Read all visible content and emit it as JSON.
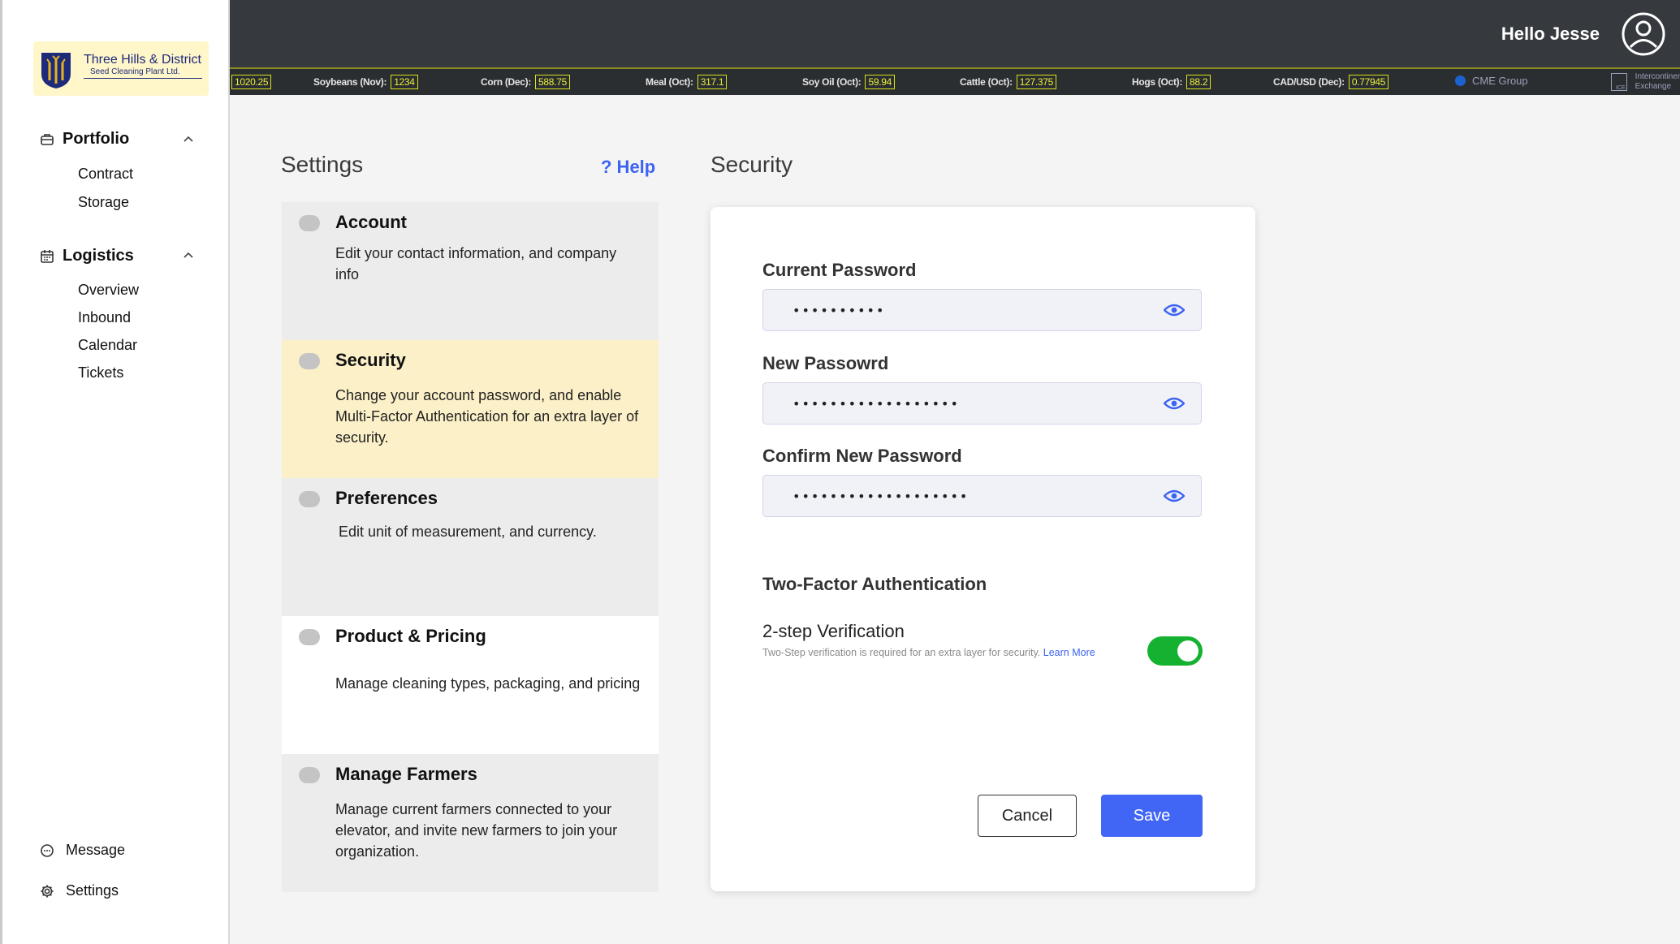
{
  "brand": {
    "name": "Three Hills & District",
    "subtitle": "Seed Cleaning Plant Ltd."
  },
  "sidebar": {
    "sections": [
      {
        "label": "Portfolio",
        "icon": "briefcase-icon",
        "items": [
          "Contract",
          "Storage"
        ]
      },
      {
        "label": "Logistics",
        "icon": "calendar-icon",
        "items": [
          "Overview",
          "Inbound",
          "Calendar",
          "Tickets"
        ]
      }
    ],
    "bottom": [
      {
        "label": "Message",
        "icon": "chat-icon"
      },
      {
        "label": "Settings",
        "icon": "gear-icon"
      }
    ]
  },
  "header": {
    "greeting": "Hello Jesse",
    "avatar_icon": "user-circle-icon"
  },
  "ticker": {
    "items": [
      {
        "label": "",
        "value": "1020.25"
      },
      {
        "label": "Soybeans (Nov):",
        "value": "1234"
      },
      {
        "label": "Corn (Dec):",
        "value": "588.75"
      },
      {
        "label": "Meal (Oct):",
        "value": "317.1"
      },
      {
        "label": "Soy Oil (Oct):",
        "value": "59.94"
      },
      {
        "label": "Cattle (Oct):",
        "value": "127.375"
      },
      {
        "label": "Hogs (Oct):",
        "value": "88.2"
      },
      {
        "label": "CAD/USD (Dec):",
        "value": "0.77945"
      }
    ],
    "sources": [
      "CME Group",
      "Intercontinental",
      "Exchange"
    ],
    "ice_mark": "ICE"
  },
  "settings": {
    "title": "Settings",
    "help_label": "? Help",
    "items": [
      {
        "title": "Account",
        "description": "Edit your contact information, and company info"
      },
      {
        "title": "Security",
        "description": "Change your account password, and enable Multi-Factor Authentication for an extra layer of security."
      },
      {
        "title": "Preferences",
        "description": "Edit unit of measurement, and currency."
      },
      {
        "title": "Product & Pricing",
        "description": "Manage cleaning types, packaging, and pricing"
      },
      {
        "title": "Manage Farmers",
        "description": "Manage current farmers connected to your elevator, and invite new farmers to join your organization."
      }
    ]
  },
  "security": {
    "title": "Security",
    "current_password": {
      "label": "Current Password",
      "value": "••••••••••"
    },
    "new_password": {
      "label": "New Passowrd",
      "value": "••••••••••••••••••"
    },
    "confirm_password": {
      "label": "Confirm New Password",
      "value": "•••••••••••••••••••"
    },
    "two_factor": {
      "section_title": "Two-Factor Authentication",
      "label": "2-step Verification",
      "description": "Two-Step verification is required for an extra layer for security.",
      "learn_more": "Learn More",
      "enabled": true,
      "toggle_color": "#15b231"
    },
    "cancel_label": "Cancel",
    "save_label": "Save",
    "accent_color": "#4166f5"
  }
}
